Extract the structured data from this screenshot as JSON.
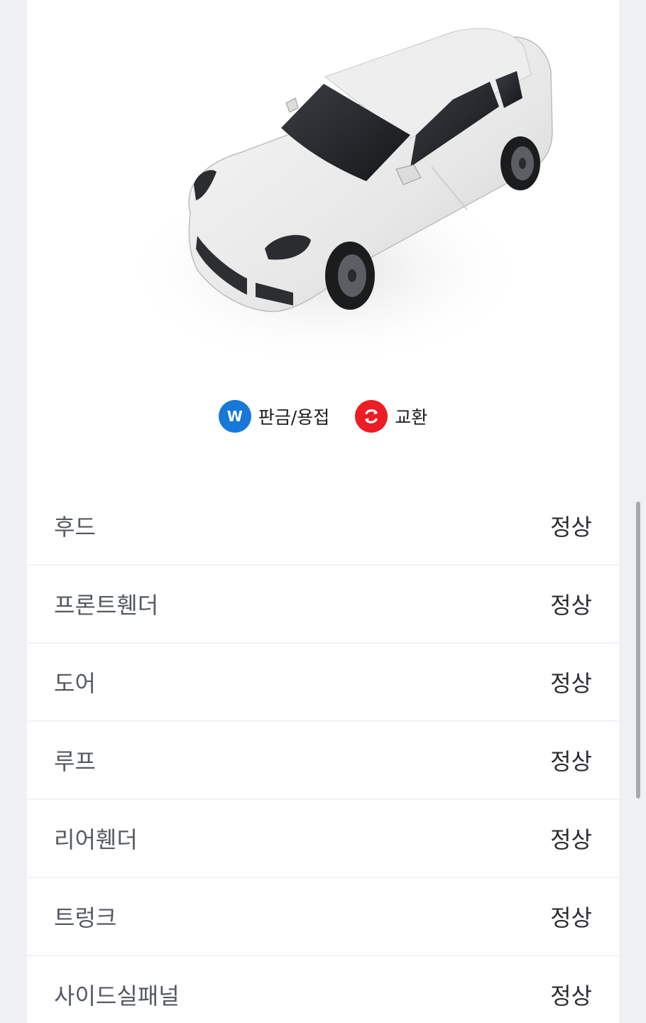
{
  "legend": [
    {
      "badge_text": "W",
      "label": "판금/용접",
      "color": "#1778d8"
    },
    {
      "badge_text": "",
      "label": "교환",
      "color": "#ee1c24",
      "icon": "refresh-icon"
    }
  ],
  "parts": [
    {
      "name": "후드",
      "status": "정상"
    },
    {
      "name": "프론트휀더",
      "status": "정상"
    },
    {
      "name": "도어",
      "status": "정상"
    },
    {
      "name": "루프",
      "status": "정상"
    },
    {
      "name": "리어휀더",
      "status": "정상"
    },
    {
      "name": "트렁크",
      "status": "정상"
    },
    {
      "name": "사이드실패널",
      "status": "정상"
    }
  ]
}
